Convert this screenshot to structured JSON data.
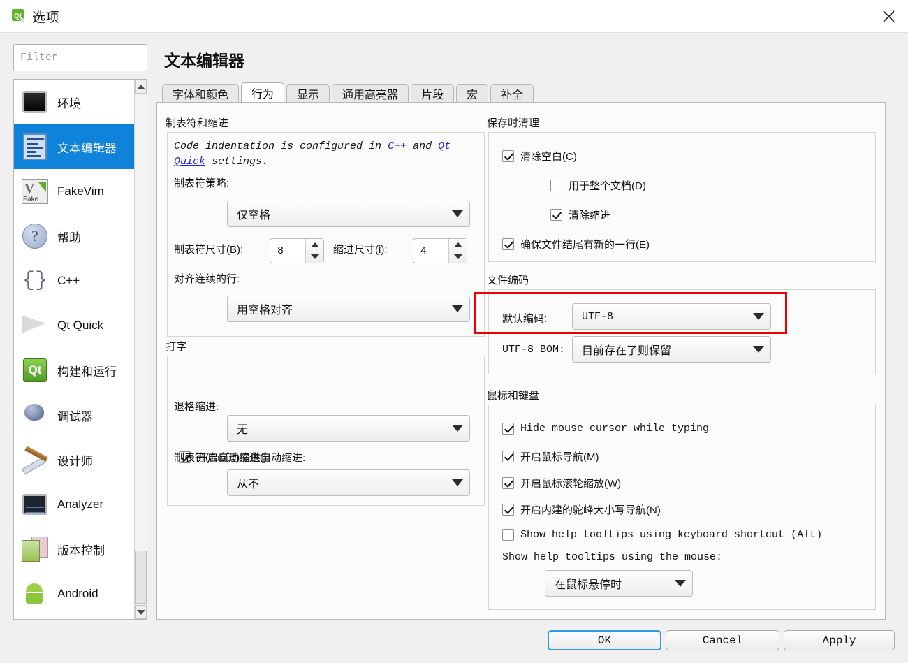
{
  "window": {
    "title": "选项",
    "app_icon": "qt-logo-icon",
    "close_icon": "close-icon"
  },
  "filter": {
    "placeholder": "Filter",
    "value": ""
  },
  "sidebar": {
    "items": [
      {
        "label": "环境",
        "icon": "environment-icon",
        "selected": false
      },
      {
        "label": "文本编辑器",
        "icon": "text-editor-icon",
        "selected": true
      },
      {
        "label": "FakeVim",
        "icon": "fakevim-icon",
        "selected": false
      },
      {
        "label": "帮助",
        "icon": "help-icon",
        "selected": false
      },
      {
        "label": "C++",
        "icon": "cpp-icon",
        "selected": false
      },
      {
        "label": "Qt Quick",
        "icon": "qtquick-icon",
        "selected": false
      },
      {
        "label": "构建和运行",
        "icon": "build-run-icon",
        "selected": false
      },
      {
        "label": "调试器",
        "icon": "debugger-icon",
        "selected": false
      },
      {
        "label": "设计师",
        "icon": "designer-icon",
        "selected": false
      },
      {
        "label": "Analyzer",
        "icon": "analyzer-icon",
        "selected": false
      },
      {
        "label": "版本控制",
        "icon": "version-control-icon",
        "selected": false
      },
      {
        "label": "Android",
        "icon": "android-icon",
        "selected": false
      }
    ],
    "selected_color": "#0f82d9"
  },
  "page": {
    "title": "文本编辑器"
  },
  "tabs": [
    {
      "label": "字体和颜色",
      "active": false
    },
    {
      "label": "行为",
      "active": true
    },
    {
      "label": "显示",
      "active": false
    },
    {
      "label": "通用高亮器",
      "active": false
    },
    {
      "label": "片段",
      "active": false
    },
    {
      "label": "宏",
      "active": false
    },
    {
      "label": "补全",
      "active": false
    }
  ],
  "tabs_indent": {
    "group_title": "制表符和缩进",
    "note_prefix": "Code indentation is configured in ",
    "note_link1": "C++",
    "note_mid": " and ",
    "note_link2": "Qt Quick",
    "note_suffix": " settings.",
    "tab_policy_label": "制表符策略:",
    "tab_policy_value": "仅空格",
    "tab_size_label": "制表符尺寸(B):",
    "tab_size_value": "8",
    "indent_size_label": "缩进尺寸(i):",
    "indent_size_value": "4",
    "continuation_label": "对齐连续的行:",
    "continuation_value": "用空格对齐"
  },
  "typing": {
    "group_title": "打字",
    "auto_indent_label": "开启自动缩进()",
    "auto_indent_checked": true,
    "backspace_label": "退格缩进:",
    "backspace_value": "无",
    "tab_key_label": "制表符(Tab键)提供自动缩进:",
    "tab_key_value": "从不"
  },
  "cleanup": {
    "group_title": "保存时清理",
    "clean_whitespace_label": "清除空白(C)",
    "clean_whitespace_checked": true,
    "whole_document_label": "用于整个文档(D)",
    "whole_document_checked": false,
    "clean_indent_label": "清除缩进",
    "clean_indent_checked": true,
    "ensure_newline_label": "确保文件结尾有新的一行(E)",
    "ensure_newline_checked": true
  },
  "encoding": {
    "group_title": "文件编码",
    "default_label": "默认编码:",
    "default_value": "UTF-8",
    "bom_label": "UTF-8 BOM:",
    "bom_value": "目前存在了则保留",
    "highlight_color": "#ee0000"
  },
  "mouse_keyboard": {
    "group_title": "鼠标和键盘",
    "hide_cursor_label": "Hide mouse cursor while typing",
    "hide_cursor_checked": true,
    "mouse_nav_label": "开启鼠标导航(M)",
    "mouse_nav_checked": true,
    "wheel_zoom_label": "开启鼠标滚轮缩放(W)",
    "wheel_zoom_checked": true,
    "camel_case_label": "开启内建的驼峰大小写导航(N)",
    "camel_case_checked": true,
    "tooltip_shortcut_label": "Show help tooltips using keyboard shortcut (Alt)",
    "tooltip_shortcut_checked": false,
    "tooltip_mouse_label": "Show help tooltips using the mouse:",
    "tooltip_mouse_value": "在鼠标悬停时"
  },
  "footer": {
    "ok": "OK",
    "cancel": "Cancel",
    "apply": "Apply"
  }
}
